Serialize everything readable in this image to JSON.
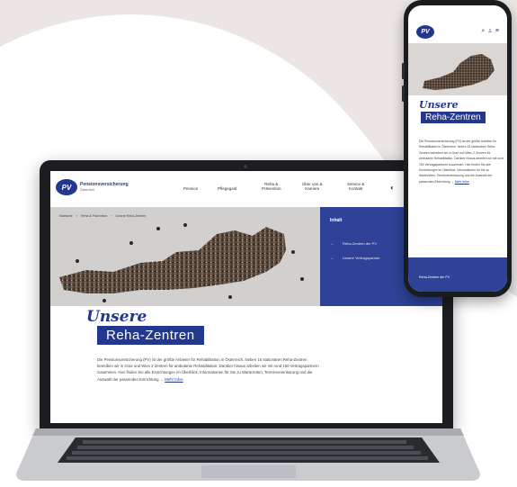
{
  "site": {
    "logo_badge": "PV",
    "logo_name": "Pensionsversicherung",
    "logo_sub": "Österreich",
    "nav": [
      "Pension",
      "Pflegegeld",
      "Reha &\nPrävention",
      "Über uns &\nKarriere",
      "Service &\nKontakt"
    ],
    "breadcrumb": [
      "Startseite",
      "Reha & Prävention",
      "Unsere Reha-Zentren"
    ],
    "toc": {
      "title": "Inhalt",
      "items": [
        "Reha-Zentren der PV",
        "Unsere Vertragspartner"
      ]
    },
    "script_word": "Unsere",
    "page_title": "Reha-Zentren",
    "intro": "Die Pensionsversicherung (PV) ist der größte Anbieter für Rehabilitation in Österreich. Neben 15 stationären Reha-Zentren betreiben wir in Graz und Wien 2 Zentren für ambulante Rehabilitation. Darüber hinaus arbeiten wir mit rund 150 Vertragspartnern zusammen. Hier finden Sie alle Einrichtungen im Überblick, Informationen für Sie zu Wartezeiten, Terminvereinbarung und die Auswahl der passenden Einrichtung",
    "more_link": "Mehr Infos"
  },
  "phone": {
    "logo_badge": "PV",
    "script_word": "Unsere",
    "page_title": "Reha-Zentren",
    "text": "Die Pensionsversicherung (PV) ist der größte Anbieter für Rehabilitation in Österreich. Neben 15 stationären Reha-Zentren betreiben wir in Graz und Wien 2 Zentren für ambulante Rehabilitation. Darüber hinaus arbeiten wir mit rund 150 Vertragspartnern zusammen. Hier finden Sie alle Einrichtungen im Überblick, Informationen für Sie zu Wartezeiten, Terminvereinbarung und die Auswahl der passenden Einrichtung",
    "more_link": "Mehr Infos",
    "footer_text": "Reha-Zentren der PV"
  },
  "colors": {
    "brand": "#24378f",
    "panel": "#2e4397",
    "background": "#ebe6e4"
  },
  "icons": [
    "contrast-icon",
    "search-icon",
    "user-icon",
    "menu-icon",
    "arrow-right-icon"
  ]
}
